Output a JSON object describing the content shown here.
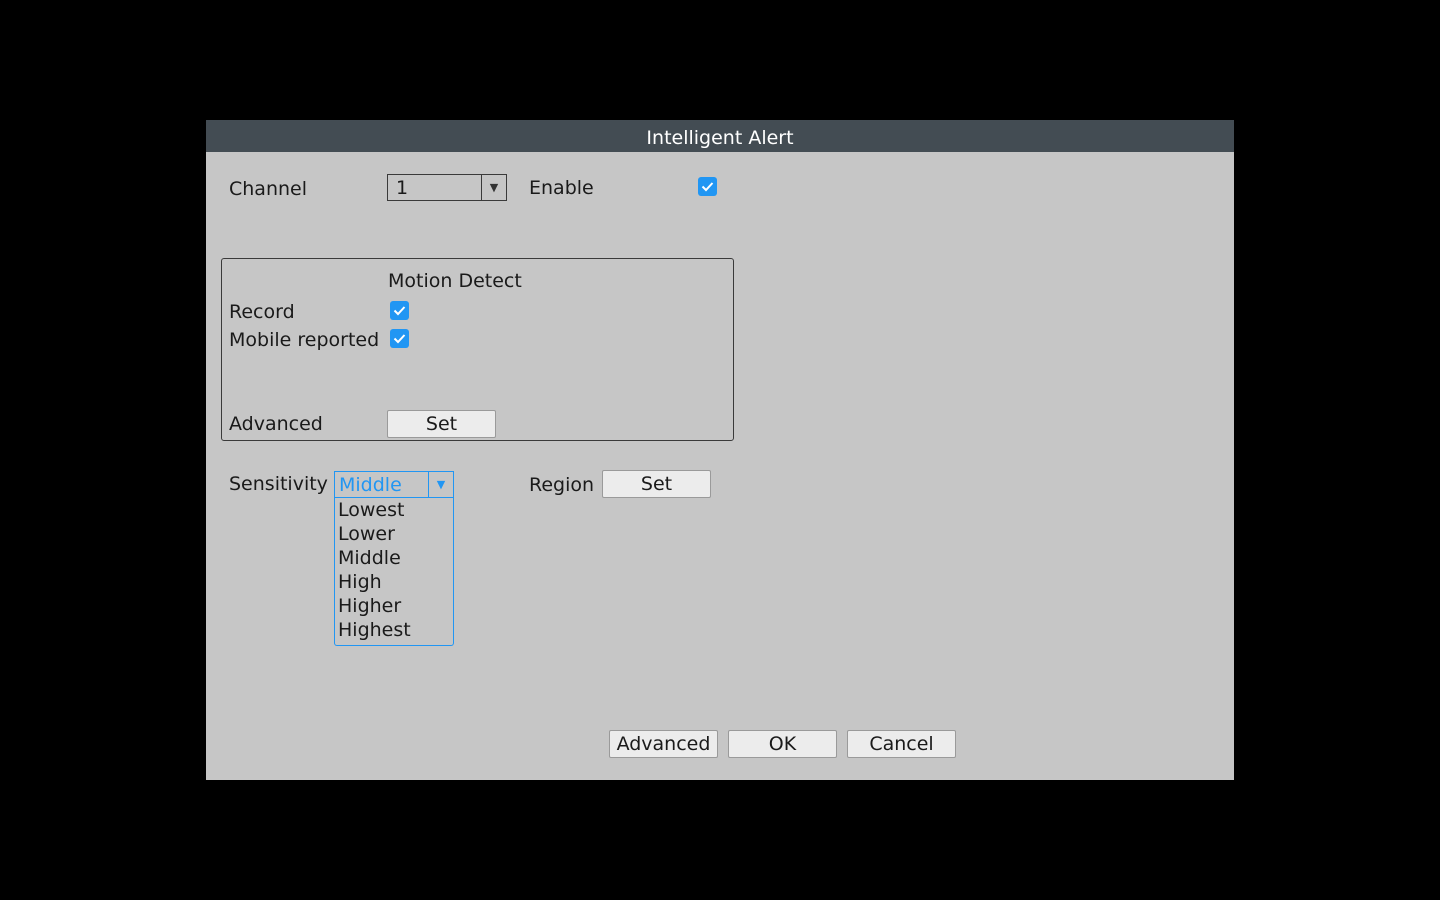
{
  "dialog": {
    "title": "Intelligent Alert"
  },
  "channel": {
    "label": "Channel",
    "value": "1"
  },
  "enable": {
    "label": "Enable",
    "checked": true
  },
  "motion_group": {
    "header": "Motion Detect",
    "record_label": "Record",
    "record_checked": true,
    "mobile_label": "Mobile reported",
    "mobile_checked": true,
    "advanced_label": "Advanced",
    "set_label": "Set"
  },
  "sensitivity": {
    "label": "Sensitivity",
    "value": "Middle",
    "options": [
      "Lowest",
      "Lower",
      "Middle",
      "High",
      "Higher",
      "Highest"
    ]
  },
  "region": {
    "label": "Region",
    "set_label": "Set"
  },
  "footer": {
    "advanced_label": "Advanced",
    "ok_label": "OK",
    "cancel_label": "Cancel"
  },
  "icons": {
    "dropdown_arrow": "chevron-down-icon",
    "checkbox": "checkmark-icon"
  },
  "colors": {
    "accent": "#2196f3",
    "titlebar": "#434c53",
    "dialog_bg": "#c6c6c6"
  }
}
